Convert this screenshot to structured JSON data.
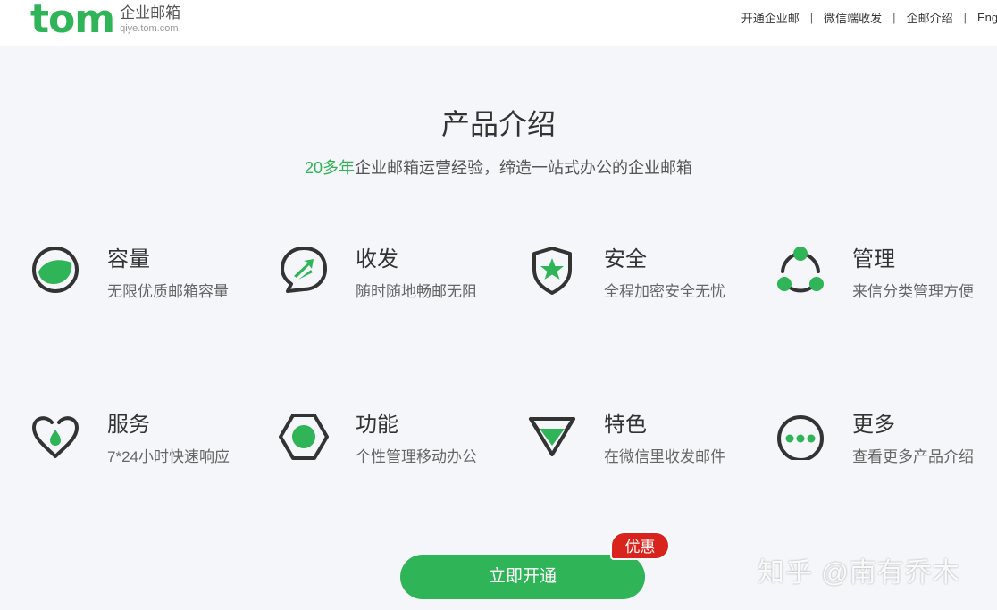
{
  "header": {
    "logo_word": "tom",
    "logo_cn": "企业邮箱",
    "logo_url": "qiye.tom.com",
    "nav": [
      "开通企业邮",
      "微信端收发",
      "企邮介绍",
      "Engl"
    ]
  },
  "intro": {
    "title": "产品介绍",
    "subtitle_highlight": "20多年",
    "subtitle_rest": "企业邮箱运营经验，缔造一站式办公的企业邮箱"
  },
  "features": [
    {
      "title": "容量",
      "desc": "无限优质邮箱容量",
      "icon": "capacity-icon"
    },
    {
      "title": "收发",
      "desc": "随时随地畅邮无阻",
      "icon": "send-receive-icon"
    },
    {
      "title": "安全",
      "desc": "全程加密安全无忧",
      "icon": "shield-star-icon"
    },
    {
      "title": "管理",
      "desc": "来信分类管理方便",
      "icon": "management-icon"
    },
    {
      "title": "服务",
      "desc": "7*24小时快速响应",
      "icon": "heart-drop-icon"
    },
    {
      "title": "功能",
      "desc": "个性管理移动办公",
      "icon": "hexagon-icon"
    },
    {
      "title": "特色",
      "desc": "在微信里收发邮件",
      "icon": "diamond-icon"
    },
    {
      "title": "更多",
      "desc": "查看更多产品介绍",
      "icon": "more-icon"
    }
  ],
  "cta": {
    "label": "立即开通",
    "badge": "优惠"
  },
  "watermark": "知乎 @南有乔木",
  "colors": {
    "accent": "#2fb457",
    "badge": "#d9231d",
    "icon_stroke": "#333333"
  }
}
